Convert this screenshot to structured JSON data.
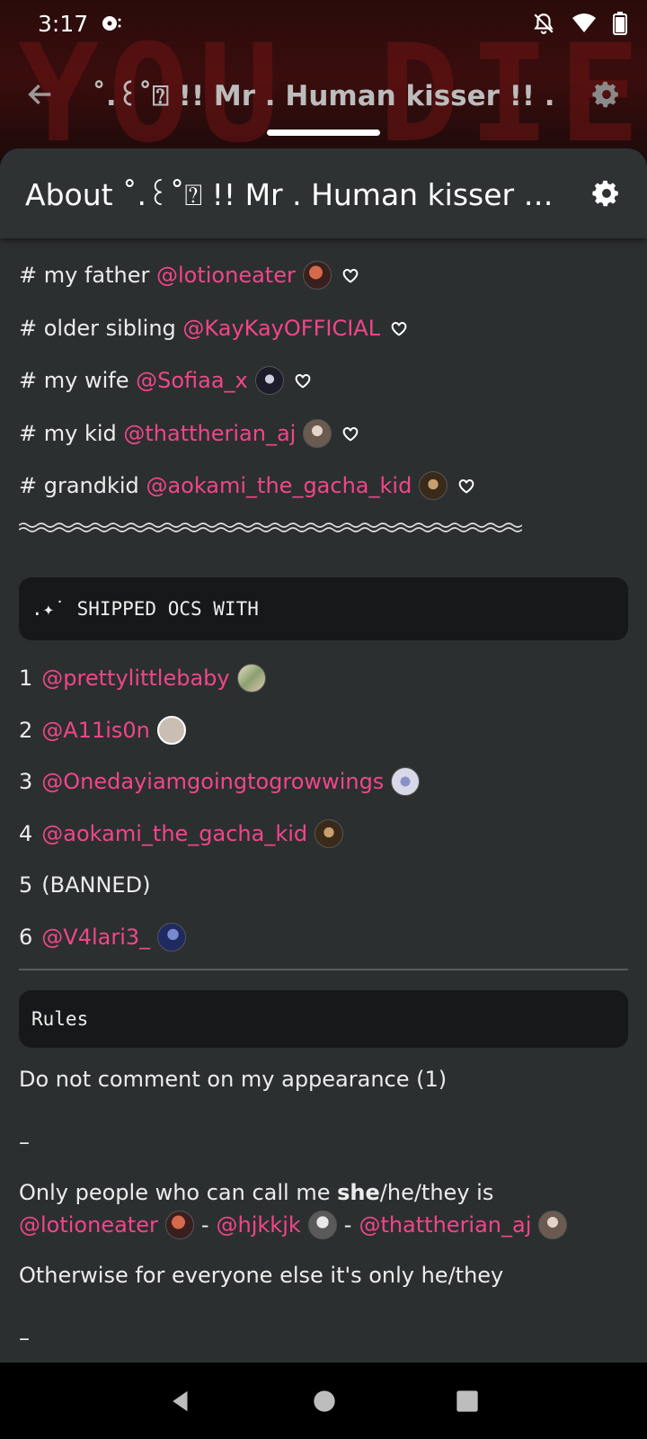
{
  "status_bar": {
    "time": "3:17"
  },
  "app_bar": {
    "title": "˚.꒰˚⍰ !! Mr . Human kisser !! ."
  },
  "background": {
    "banner_text": "YOU DIED!"
  },
  "sheet": {
    "title": "About ˚.꒰˚⍰ !! Mr . Human kisser !!..."
  },
  "family": [
    {
      "prefix": "# my father",
      "mention": "@lotioneater"
    },
    {
      "prefix": "# older sibling",
      "mention": "@KayKayOFFICIAL"
    },
    {
      "prefix": "# my wife",
      "mention": "@Sofiaa_x"
    },
    {
      "prefix": "# my kid",
      "mention": "@thattherian_aj"
    },
    {
      "prefix": "# grandkid",
      "mention": "@aokami_the_gacha_kid"
    }
  ],
  "shipped": {
    "header": ".✦˙ SHIPPED OCS WITH",
    "items": [
      {
        "num": "1",
        "mention": "@prettylittlebaby"
      },
      {
        "num": "2",
        "mention": "@A11is0n"
      },
      {
        "num": "3",
        "mention": "@Onedayiamgoingtogrowwings"
      },
      {
        "num": "4",
        "mention": "@aokami_the_gacha_kid"
      },
      {
        "num": "5",
        "text": "(BANNED)"
      },
      {
        "num": "6",
        "mention": "@V4lari3_"
      }
    ]
  },
  "rules": {
    "header": "Rules",
    "rule1": "Do not comment on my appearance (1)",
    "dash1": "–",
    "pronoun_pre": "Only people who can call me ",
    "pronoun_bold": "she",
    "pronoun_post": "/he/they is",
    "allowed": [
      "@lotioneater",
      "@hjkkjk",
      "@thattherian_aj"
    ],
    "separator": "-",
    "otherwise": "Otherwise for everyone else it's only he/they",
    "dash2": "–"
  },
  "colors": {
    "mention": "#f0468a",
    "sheet_bg": "#2c2f30",
    "code_bg": "#161819"
  }
}
